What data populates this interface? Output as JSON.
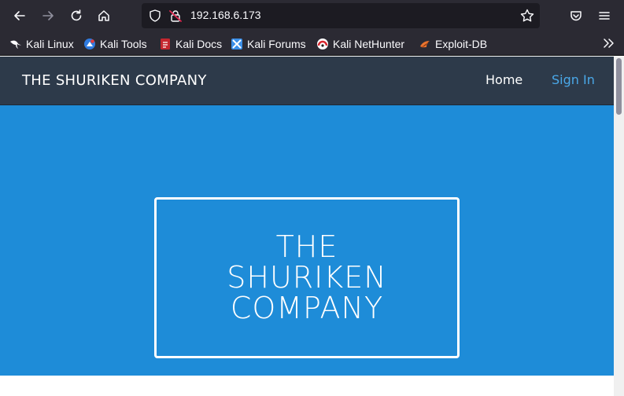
{
  "browser": {
    "url": "192.168.6.173",
    "icons": {
      "back": "arrow-left-icon",
      "forward": "arrow-right-icon",
      "reload": "reload-icon",
      "home": "home-icon",
      "tracking": "shield-icon",
      "insecure": "lock-insecure-icon",
      "bookmark": "star-icon",
      "pocket": "pocket-icon",
      "menu": "hamburger-menu-icon",
      "overflow": "chevron-double-right-icon"
    },
    "colors": {
      "chrome": "#2b2a33",
      "url_field": "#1c1b22"
    }
  },
  "bookmarks": [
    {
      "label": "Kali Linux",
      "icon": "kali-dragon-icon"
    },
    {
      "label": "Kali Tools",
      "icon": "kali-tools-icon"
    },
    {
      "label": "Kali Docs",
      "icon": "kali-docs-icon"
    },
    {
      "label": "Kali Forums",
      "icon": "kali-forums-icon"
    },
    {
      "label": "Kali NetHunter",
      "icon": "kali-nethunter-icon"
    },
    {
      "label": "Exploit-DB",
      "icon": "exploit-db-icon"
    }
  ],
  "site": {
    "brand": "THE SHURIKEN COMPANY",
    "nav": {
      "home": "Home",
      "signin": "Sign In"
    },
    "hero": {
      "line1": "THE",
      "line2": "SHURIKEN",
      "line3": "COMPANY"
    },
    "colors": {
      "header": "#2d3a4a",
      "hero": "#1e8cd8",
      "link_active": "#ffffff",
      "link_accent": "#4aa8e8"
    }
  }
}
